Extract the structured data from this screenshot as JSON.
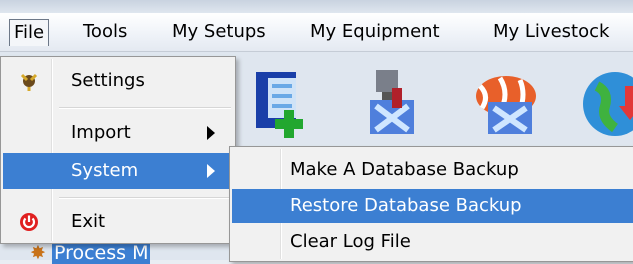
{
  "menubar": {
    "items": [
      {
        "label": "File"
      },
      {
        "label": "Tools"
      },
      {
        "label": "My Setups"
      },
      {
        "label": "My Equipment"
      },
      {
        "label": "My Livestock"
      }
    ]
  },
  "file_menu": {
    "items": [
      {
        "label": "Settings",
        "icon": "settings-icon"
      },
      {
        "label": "Import",
        "has_submenu": true
      },
      {
        "label": "System",
        "has_submenu": true,
        "highlighted": true
      },
      {
        "label": "Exit",
        "icon": "power-icon"
      }
    ]
  },
  "system_submenu": {
    "items": [
      {
        "label": "Make A Database Backup"
      },
      {
        "label": "Restore Database Backup",
        "highlighted": true
      },
      {
        "label": "Clear Log File"
      }
    ]
  },
  "tree": {
    "partial_item": "Process M"
  },
  "colors": {
    "highlight": "#3c7fd2",
    "menu_bg": "#f1f1f1",
    "power_red": "#e02020"
  }
}
